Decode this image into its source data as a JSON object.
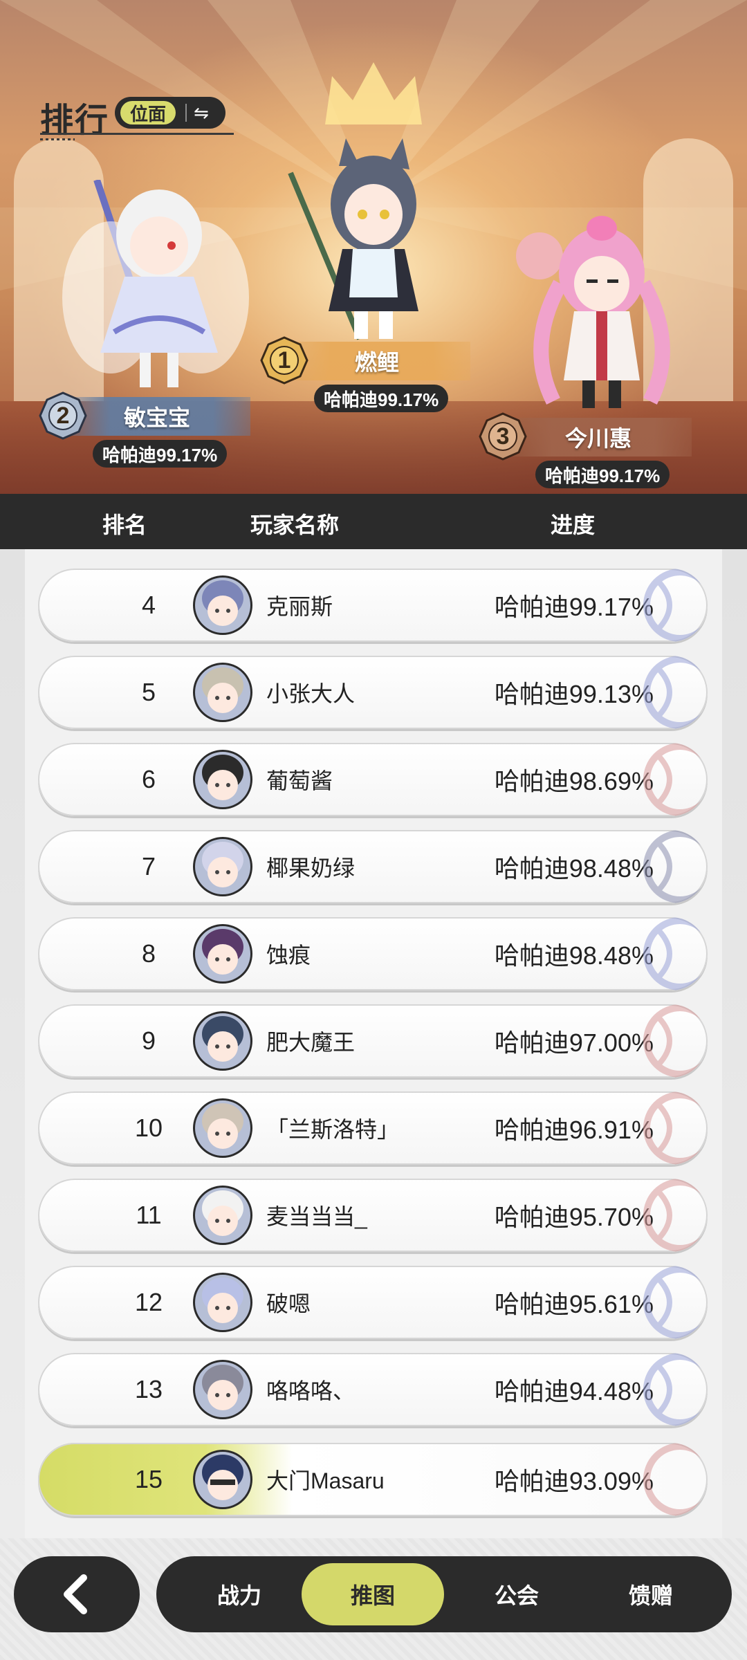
{
  "header": {
    "title": "排行",
    "mode_label": "位面",
    "swap_icon": "swap-arrows-icon"
  },
  "podium": [
    {
      "rank": "1",
      "name": "燃鲤",
      "score": "哈帕迪99.17%"
    },
    {
      "rank": "2",
      "name": "敏宝宝",
      "score": "哈帕迪99.17%"
    },
    {
      "rank": "3",
      "name": "今川惠",
      "score": "哈帕迪99.17%"
    }
  ],
  "columns": {
    "rank": "排名",
    "player": "玩家名称",
    "progress": "进度"
  },
  "rows": [
    {
      "rank": "4",
      "name": "克丽斯",
      "score": "哈帕迪99.17%"
    },
    {
      "rank": "5",
      "name": "小张大人",
      "score": "哈帕迪99.13%"
    },
    {
      "rank": "6",
      "name": "葡萄酱",
      "score": "哈帕迪98.69%"
    },
    {
      "rank": "7",
      "name": "椰果奶绿",
      "score": "哈帕迪98.48%"
    },
    {
      "rank": "8",
      "name": "蚀痕",
      "score": "哈帕迪98.48%"
    },
    {
      "rank": "9",
      "name": "肥大魔王",
      "score": "哈帕迪97.00%"
    },
    {
      "rank": "10",
      "name": "「兰斯洛特」",
      "score": "哈帕迪96.91%"
    },
    {
      "rank": "11",
      "name": "麦当当当_",
      "score": "哈帕迪95.70%"
    },
    {
      "rank": "12",
      "name": "破嗯",
      "score": "哈帕迪95.61%"
    },
    {
      "rank": "13",
      "name": "咯咯咯、",
      "score": "哈帕迪94.48%"
    }
  ],
  "me": {
    "rank": "15",
    "name": "大门Masaru",
    "score": "哈帕迪93.09%"
  },
  "nav": {
    "back_icon": "chevron-left-icon",
    "tabs": [
      "战力",
      "推图",
      "公会",
      "馈赠"
    ],
    "active": "推图"
  },
  "colors": {
    "accent": "#d4d86a",
    "dark": "#2b2b2b"
  }
}
